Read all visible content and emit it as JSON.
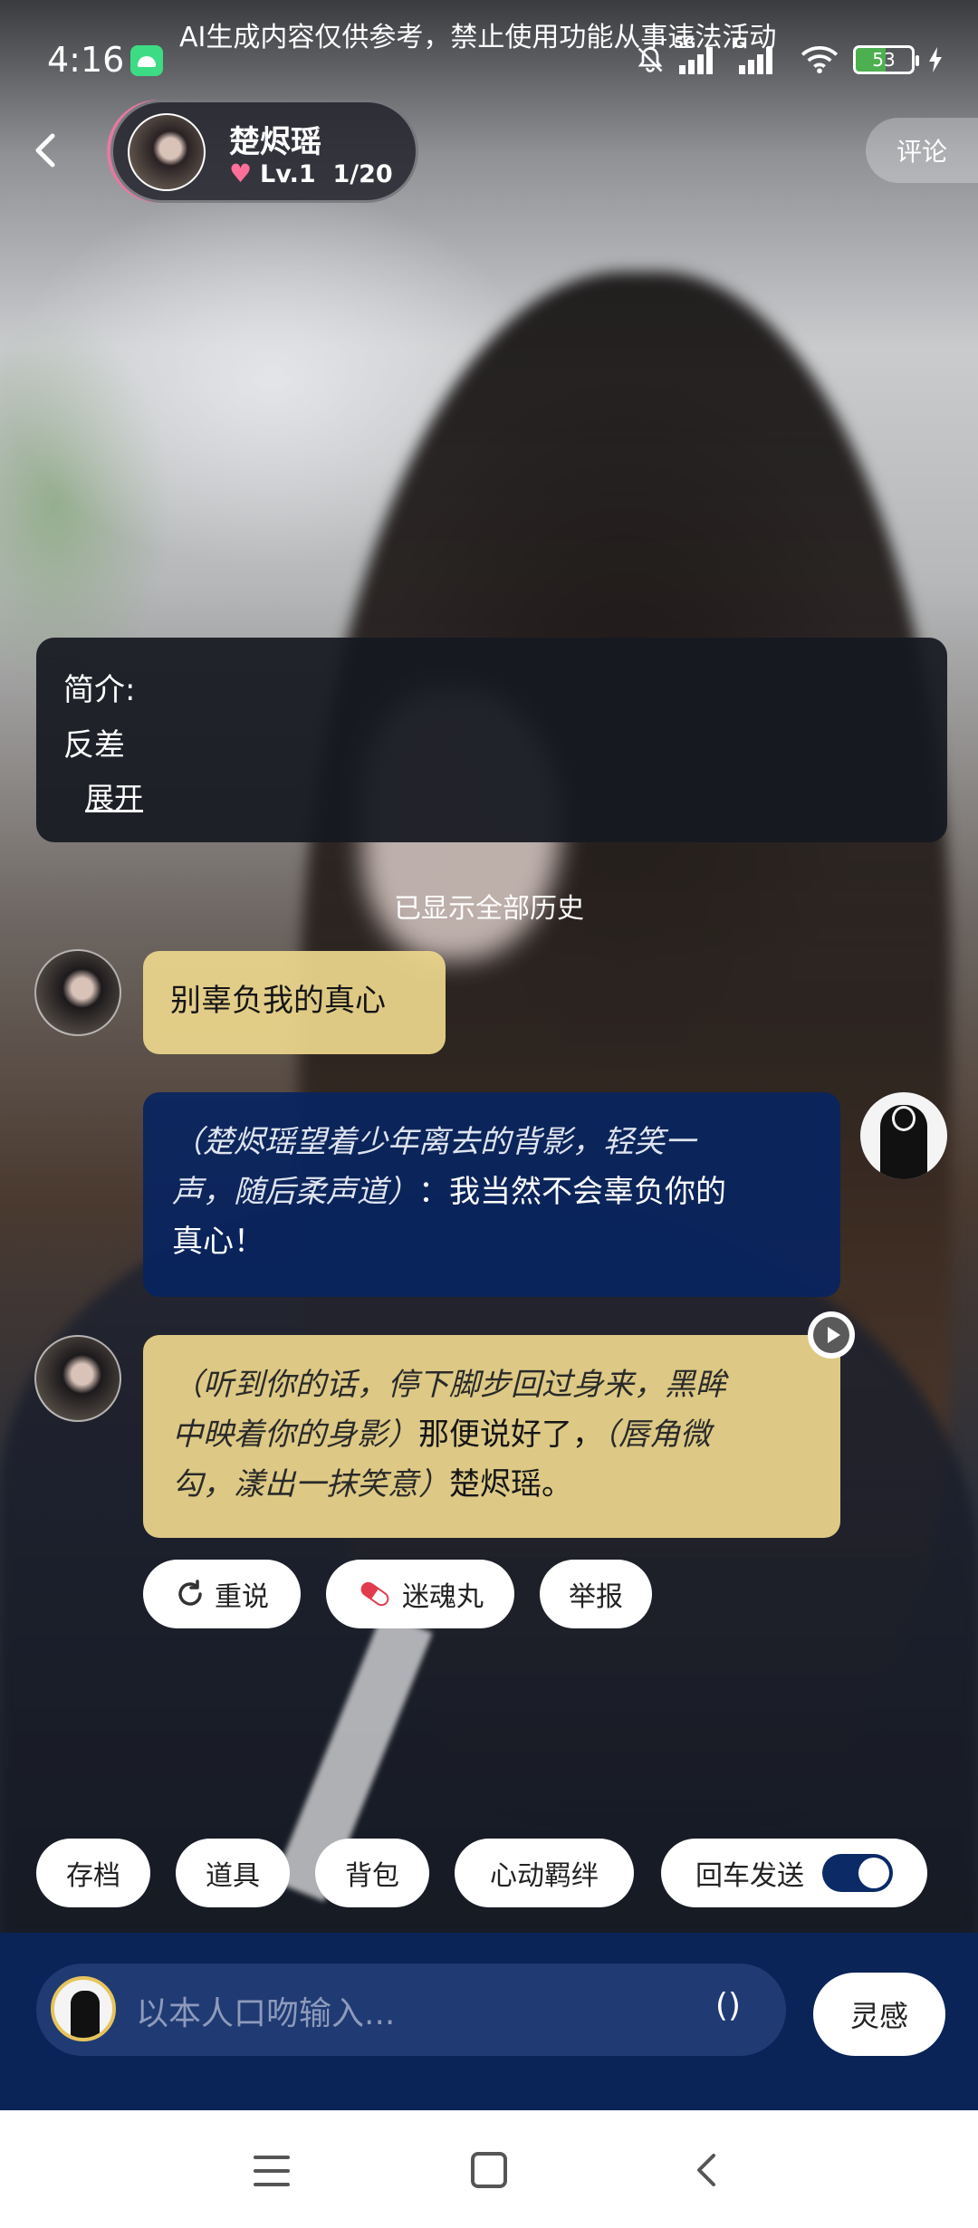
{
  "status_bar": {
    "time": "4:16",
    "notice": "AI生成内容仅供参考，禁止使用功能从事违法活动",
    "network_1": "5G",
    "network_2": "G",
    "battery": "53"
  },
  "header": {
    "character_name": "楚烬瑶",
    "level": "Lv.1",
    "progress": "1/20",
    "comment_label": "评论"
  },
  "intro": {
    "title": "简介:",
    "text": "反差",
    "expand_label": "展开"
  },
  "history_label": "已显示全部历史",
  "messages": [
    {
      "sender": "character",
      "text": "别辜负我的真心"
    },
    {
      "sender": "user",
      "action": "（楚烬瑶望着少年离去的背影，轻笑一声，随后柔声道）",
      "line_1_action": "（楚烬瑶望着少年离去的背影，轻笑一",
      "line_2_action": "声，随后柔声道）",
      "line_2_speech": "：我当然不会辜负你的",
      "line_3_speech": "真心！"
    },
    {
      "sender": "character",
      "line_1_action": "（听到你的话，停下脚步回过身来，黑眸",
      "line_2_action": "中映着你的身影）",
      "line_2_speech": "那便说好了，",
      "line_2_action_b": "（唇角微",
      "line_3_action": "勾，漾出一抹笑意）",
      "line_3_speech": "楚烬瑶。"
    }
  ],
  "message_actions": {
    "retry": "重说",
    "potion": "迷魂丸",
    "report": "举报"
  },
  "toolbar": {
    "save": "存档",
    "props": "道具",
    "bag": "背包",
    "bond": "心动羁绊",
    "enter_send": "回车发送",
    "enter_send_on": true
  },
  "composer": {
    "placeholder": "以本人口吻输入...",
    "paren": "()",
    "inspire": "灵感"
  },
  "colors": {
    "gold_bubble": "#ecd68c",
    "blue_bubble": "#082460",
    "input_bar": "#0a2458",
    "heart": "#ff6f9a"
  },
  "icons": {
    "back": "chevron-left-icon",
    "retry": "refresh-icon",
    "potion": "pill-icon",
    "play": "play-icon"
  }
}
